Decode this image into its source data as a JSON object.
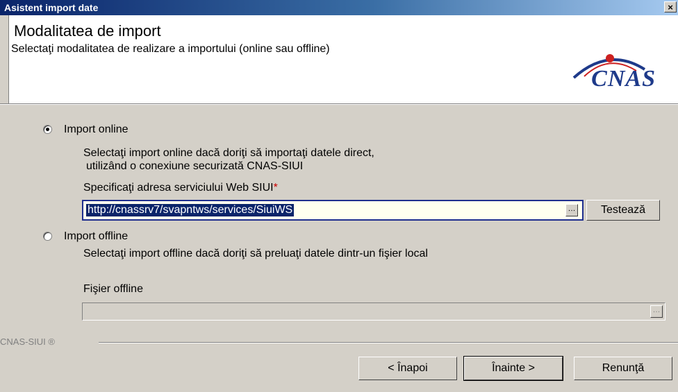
{
  "window": {
    "title": "Asistent import date",
    "close_label": "×"
  },
  "header": {
    "title": "Modalitatea de import",
    "subtitle": "Selectaţi modalitatea de realizare a importului (online sau offline)",
    "logo_text": "CNAS",
    "logo_color": "#1e3a8a"
  },
  "online": {
    "label": "Import online",
    "selected": true,
    "desc_line1": "Selectaţi import online dacă doriţi să importaţi datele direct,",
    "desc_line2": "utilizând o conexiune securizată CNAS-SIUI",
    "url_label": "Specificaţi adresa serviciului Web SIUI",
    "required_mark": "*",
    "url_value": "http://cnassrv7/svapntws/services/SiuiWS",
    "browse_label": "…",
    "test_button": "Testează"
  },
  "offline": {
    "label": "Import offline",
    "selected": false,
    "desc": "Selectaţi import offline dacă doriţi să preluaţi datele dintr-un fişier local",
    "file_label": "Fişier offline",
    "file_value": "",
    "browse_label": "…"
  },
  "footer": {
    "brand": "CNAS-SIUI ®",
    "back_button": "< Înapoi",
    "next_button": "Înainte >",
    "cancel_button": "Renunţă"
  }
}
